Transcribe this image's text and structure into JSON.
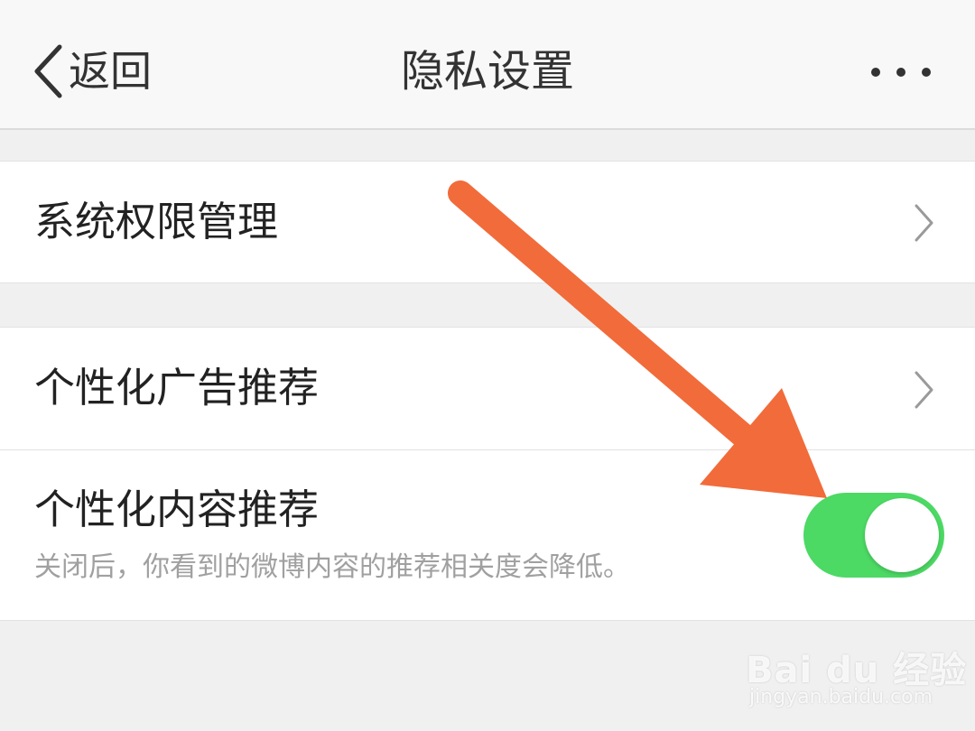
{
  "navbar": {
    "back_label": "返回",
    "title": "隐私设置"
  },
  "settings": {
    "permissions_label": "系统权限管理",
    "ad_recommend_label": "个性化广告推荐",
    "content_recommend_label": "个性化内容推荐",
    "content_recommend_desc": "关闭后，你看到的微博内容的推荐相关度会降低。",
    "content_recommend_on": true
  },
  "colors": {
    "toggle_on": "#4cd964",
    "annotation_arrow": "#f26b3a"
  },
  "watermark": {
    "brand": "Bai du 经验",
    "url": "jingyan.baidu.com"
  }
}
